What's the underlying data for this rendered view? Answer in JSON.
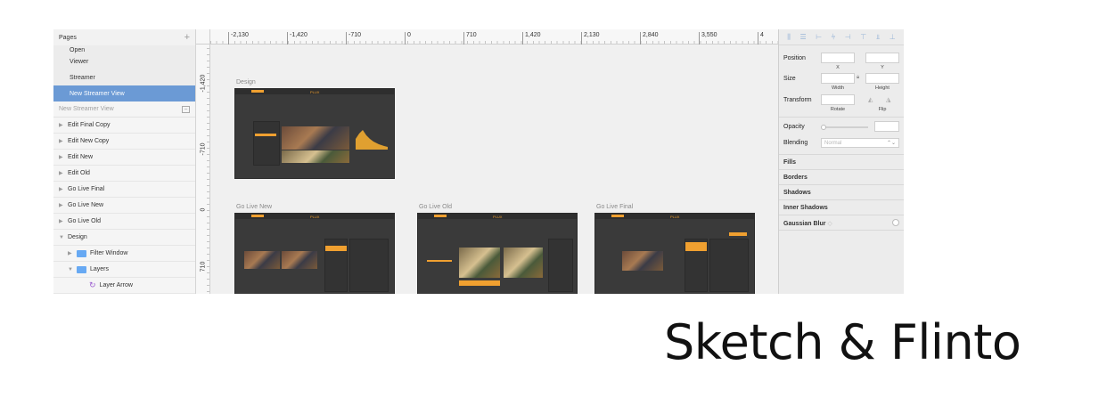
{
  "sidebar": {
    "pages_title": "Pages",
    "add_icon": "plus-icon",
    "pages": [
      "Open",
      "Viewer",
      "Streamer",
      "New Streamer View"
    ],
    "selected_page": "New Streamer View",
    "layers_title": "New Streamer View",
    "layers": [
      "Edit Final Copy",
      "Edit New Copy",
      "Edit New",
      "Edit Old",
      "Go Live Final",
      "Go Live New",
      "Go Live Old",
      "Design",
      "Filter Window",
      "Layers",
      "Layer Arrow"
    ]
  },
  "ruler": {
    "top_labels": [
      "-2,130",
      "-1,420",
      "-710",
      "0",
      "710",
      "1,420",
      "2,130",
      "2,840",
      "3,550",
      "4"
    ],
    "left_labels": [
      "-1,420",
      "-710",
      "0",
      "710"
    ]
  },
  "canvas": {
    "artboards": [
      "Design",
      "Go Live New",
      "Go Live Old",
      "Go Live Final"
    ],
    "app_logo": "PLUX"
  },
  "inspector": {
    "position": "Position",
    "x": "X",
    "y": "Y",
    "size": "Size",
    "width": "Width",
    "height": "Height",
    "transform": "Transform",
    "rotate": "Rotate",
    "flip": "Flip",
    "opacity": "Opacity",
    "blending": "Blending",
    "blending_value": "Normal",
    "fills": "Fills",
    "borders": "Borders",
    "shadows": "Shadows",
    "inner_shadows": "Inner Shadows",
    "gaussian_blur": "Gaussian Blur"
  },
  "caption": "Sketch & Flinto",
  "colors": {
    "selection": "#6b9ad5",
    "accent": "#f0a030",
    "folder": "#67a9f3"
  }
}
